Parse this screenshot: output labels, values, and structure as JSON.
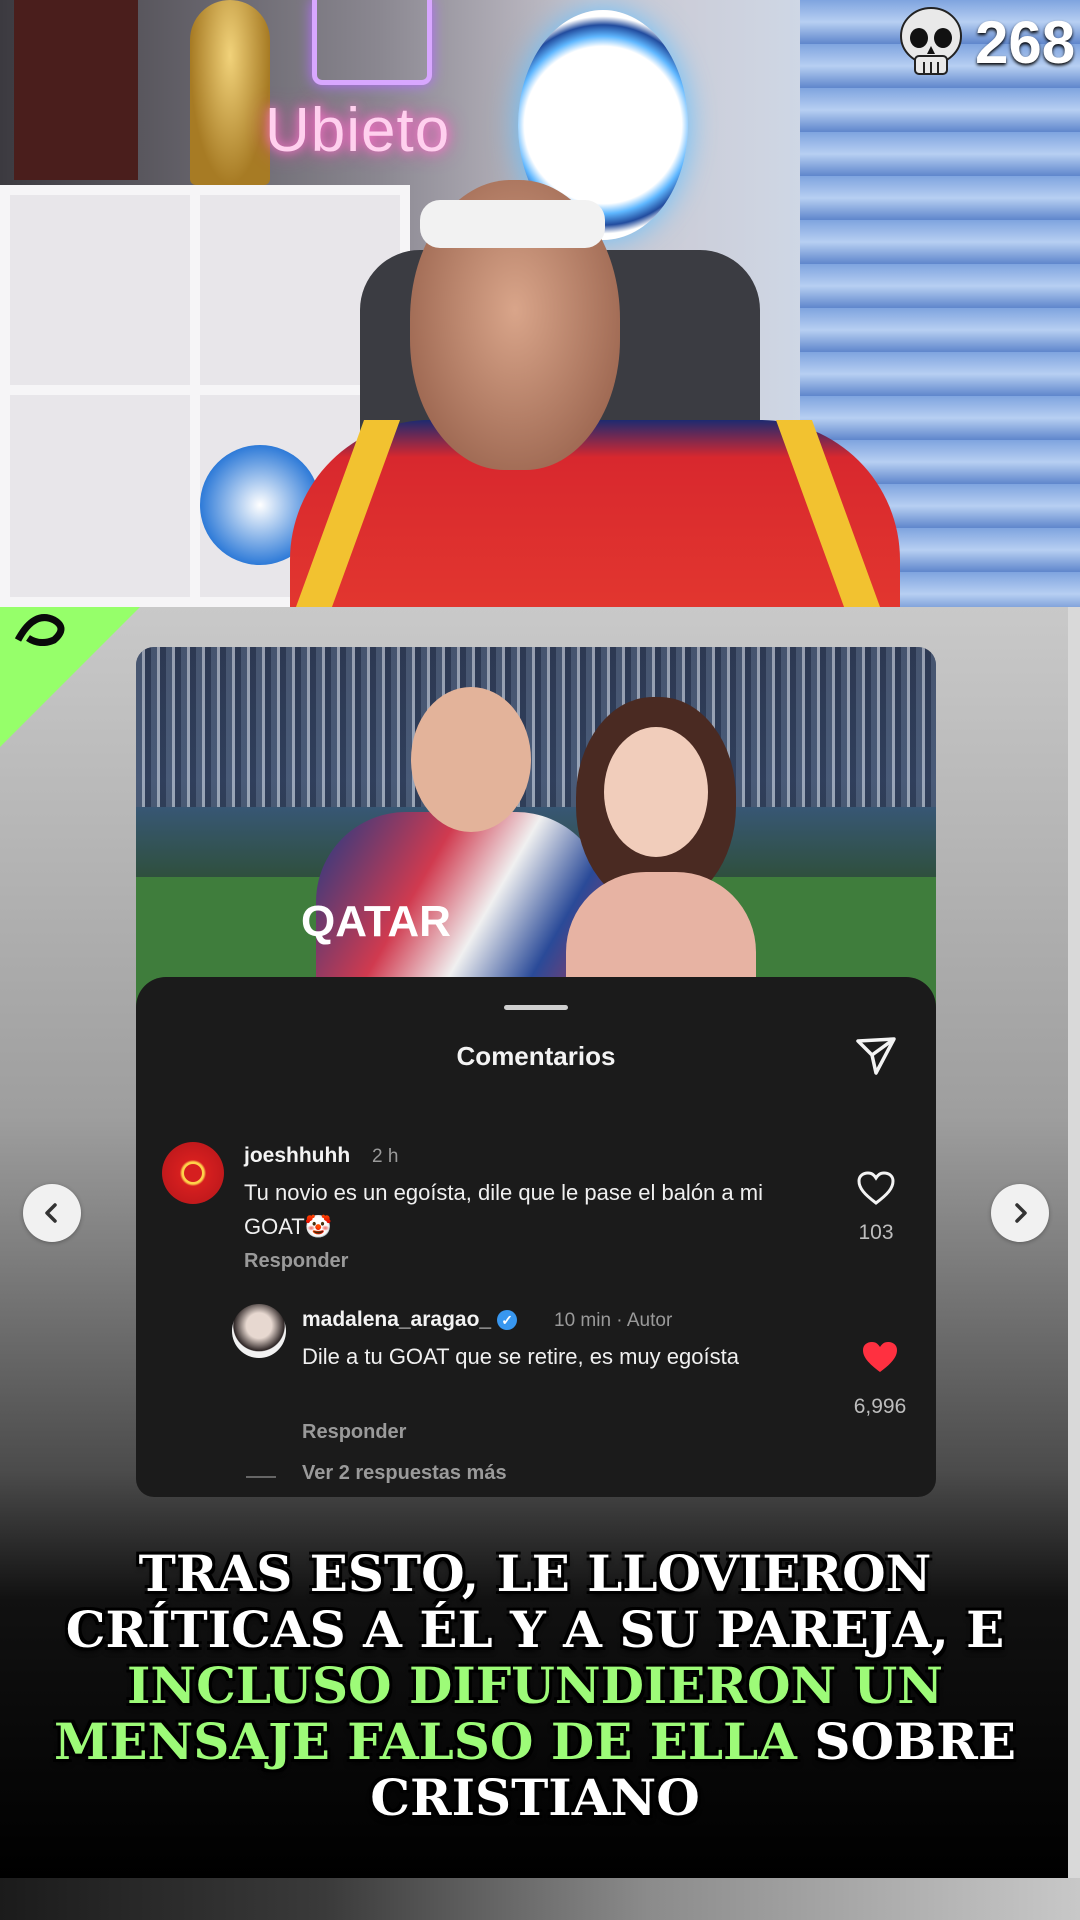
{
  "stream": {
    "neon_sign": "Ubieto",
    "viewer_count": "268"
  },
  "post": {
    "jersey_sponsor": "QATAR"
  },
  "comments_sheet": {
    "title": "Comentarios",
    "comments": [
      {
        "username": "joeshhuhh",
        "time": "2 h",
        "text": "Tu novio es un egoísta, dile que le pase el balón a mi GOAT🤡",
        "reply_label": "Responder",
        "likes": "103",
        "liked": false
      },
      {
        "username": "madalena_aragao_",
        "verified": true,
        "time": "10 min · Autor",
        "text": "Dile a tu GOAT que se retire, es muy egoísta",
        "reply_label": "Responder",
        "likes": "6,996",
        "liked": true
      }
    ],
    "view_more": "Ver 2 respuestas más"
  },
  "caption": {
    "line1": "TRAS ESTO, LE LLOVIERON",
    "line2": "CRÍTICAS A ÉL Y A SU PAREJA, E",
    "highlight1": "INCLUSO DIFUNDIERON UN",
    "highlight2": "MENSAJE FALSO DE ELLA",
    "line4_rest": " SOBRE",
    "line5": "CRISTIANO"
  },
  "colors": {
    "highlight_green": "#9dfb78",
    "like_red": "#ff3040",
    "corner_green": "#96ff6a"
  },
  "icons": [
    "skull-icon",
    "share-send-icon",
    "heart-icon",
    "chevron-left-icon",
    "chevron-right-icon",
    "verified-badge-icon",
    "club-crest-avatar"
  ]
}
